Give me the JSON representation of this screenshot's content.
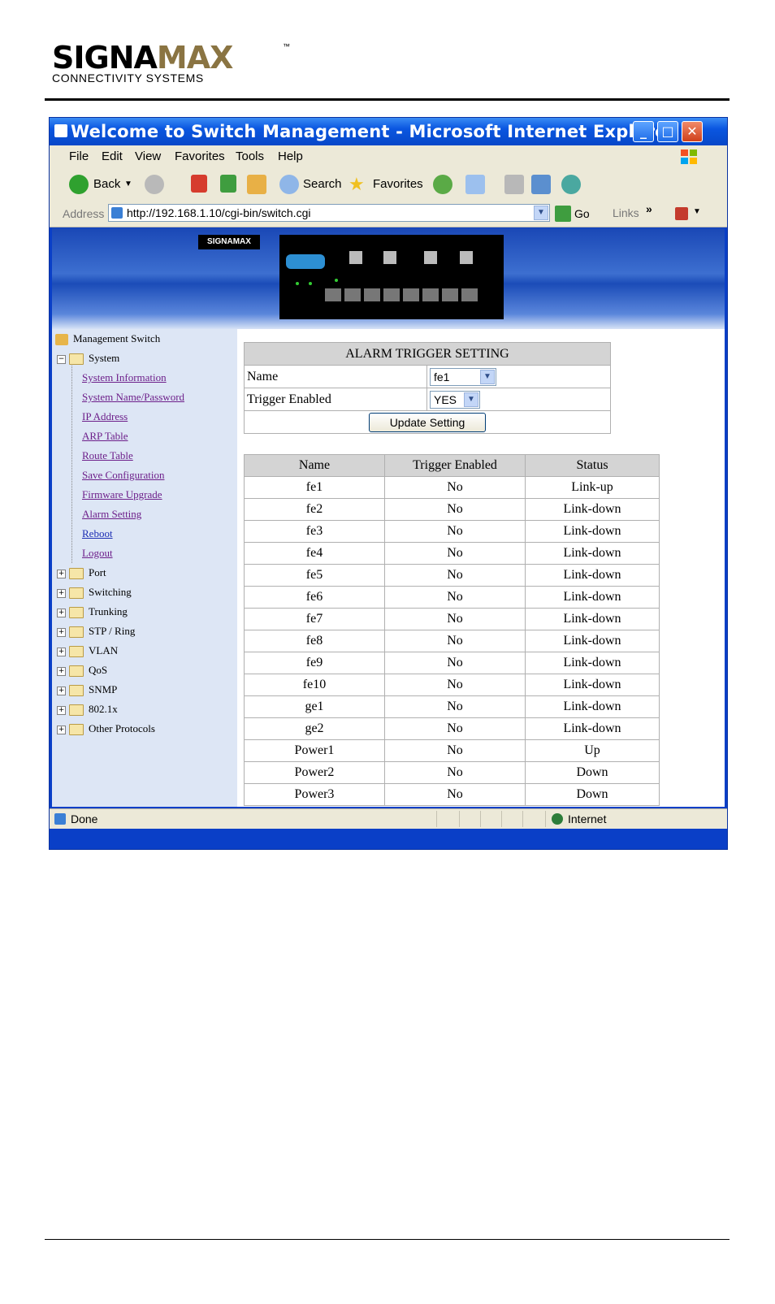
{
  "logo": {
    "brand_part1": "SIGNA",
    "brand_part2": "MAX",
    "tm": "™",
    "tagline": "CONNECTIVITY SYSTEMS"
  },
  "window": {
    "title": "Welcome to Switch Management - Microsoft Internet Explorer"
  },
  "menu": {
    "items": [
      {
        "label": "File"
      },
      {
        "label": "Edit"
      },
      {
        "label": "View"
      },
      {
        "label": "Favorites"
      },
      {
        "label": "Tools"
      },
      {
        "label": "Help"
      }
    ]
  },
  "toolbar": {
    "back_label": "Back",
    "search_label": "Search",
    "favorites_label": "Favorites"
  },
  "address": {
    "label": "Address",
    "url": "http://192.168.1.10/cgi-bin/switch.cgi",
    "go_label": "Go",
    "links_label": "Links"
  },
  "banner": {
    "logo_text": "SIGNAMAX"
  },
  "sidebar": {
    "root": "Management Switch",
    "system": "System",
    "links": [
      "System Information",
      "System Name/Password",
      "IP Address",
      "ARP Table",
      "Route Table",
      "Save Configuration",
      "Firmware Upgrade",
      "Alarm Setting",
      "Reboot",
      "Logout"
    ],
    "folders": [
      "Port",
      "Switching",
      "Trunking",
      "STP / Ring",
      "VLAN",
      "QoS",
      "SNMP",
      "802.1x",
      "Other Protocols"
    ]
  },
  "alarm_form": {
    "title": "ALARM TRIGGER SETTING",
    "name_label": "Name",
    "name_value": "fe1",
    "trigger_label": "Trigger Enabled",
    "trigger_value": "YES",
    "update_button": "Update Setting"
  },
  "status_table": {
    "headers": [
      "Name",
      "Trigger Enabled",
      "Status"
    ],
    "rows": [
      [
        "fe1",
        "No",
        "Link-up"
      ],
      [
        "fe2",
        "No",
        "Link-down"
      ],
      [
        "fe3",
        "No",
        "Link-down"
      ],
      [
        "fe4",
        "No",
        "Link-down"
      ],
      [
        "fe5",
        "No",
        "Link-down"
      ],
      [
        "fe6",
        "No",
        "Link-down"
      ],
      [
        "fe7",
        "No",
        "Link-down"
      ],
      [
        "fe8",
        "No",
        "Link-down"
      ],
      [
        "fe9",
        "No",
        "Link-down"
      ],
      [
        "fe10",
        "No",
        "Link-down"
      ],
      [
        "ge1",
        "No",
        "Link-down"
      ],
      [
        "ge2",
        "No",
        "Link-down"
      ],
      [
        "Power1",
        "No",
        "Up"
      ],
      [
        "Power2",
        "No",
        "Down"
      ],
      [
        "Power3",
        "No",
        "Down"
      ]
    ]
  },
  "statusbar": {
    "left": "Done",
    "zone": "Internet"
  }
}
